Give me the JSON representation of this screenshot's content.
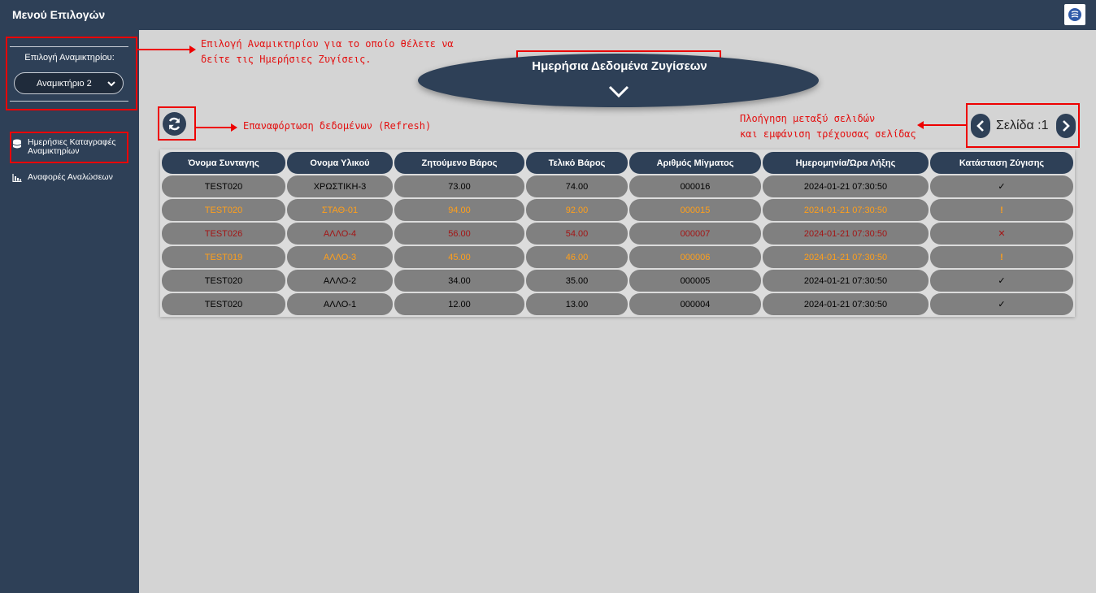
{
  "app": {
    "title": "Μενού Επιλογών"
  },
  "sidebar": {
    "select_label": "Επιλογή Αναμικτηρίου:",
    "select_value": "Αναμικτήριο 2",
    "items": [
      {
        "label": "Ημερήσιες Καταγραφές Αναμικτηρίων",
        "icon": "database-icon"
      },
      {
        "label": "Αναφορές Αναλώσεων",
        "icon": "bar-chart-icon"
      }
    ]
  },
  "main": {
    "heading": "Ημερήσια Δεδομένα Ζυγίσεων",
    "page_label": "Σελίδα :1"
  },
  "annotations": {
    "select_line1": "Επιλογή Αναμικτηρίου για το οποίο θέλετε να",
    "select_line2": "δείτε τις Ημερήσιες Ζυγίσεις.",
    "refresh": "Επαναφόρτωση δεδομένων (Refresh)",
    "paging_line1": "Πλοήγηση μεταξύ σελιδών",
    "paging_line2": "και εμφάνιση τρέχουσας σελίδας"
  },
  "colors": {
    "primary": "#2e4057",
    "ok": "#000000",
    "warning": "#ff9f1a",
    "error": "#a31515",
    "annotation": "#e31010"
  },
  "table": {
    "columns": [
      "Όνομα Συνταγης",
      "Ονομα Υλικού",
      "Ζητούμενο Βάρος",
      "Τελικό Βάρος",
      "Αριθμός Μίγματος",
      "Ημερομηνία/Ώρα Λήξης",
      "Κατάσταση Ζύγισης"
    ],
    "rows": [
      {
        "cells": [
          "TEST020",
          "ΧΡΩΣΤΙΚΗ-3",
          "73.00",
          "74.00",
          "000016",
          "2024-01-21 07:30:50",
          "✓"
        ],
        "status": "ok"
      },
      {
        "cells": [
          "TEST020",
          "ΣΤΑΘ-01",
          "94.00",
          "92.00",
          "000015",
          "2024-01-21 07:30:50",
          "!"
        ],
        "status": "warning"
      },
      {
        "cells": [
          "TEST026",
          "ΑΛΛΟ-4",
          "56.00",
          "54.00",
          "000007",
          "2024-01-21 07:30:50",
          "✕"
        ],
        "status": "error"
      },
      {
        "cells": [
          "TEST019",
          "ΑΛΛΟ-3",
          "45.00",
          "46.00",
          "000006",
          "2024-01-21 07:30:50",
          "!"
        ],
        "status": "warning"
      },
      {
        "cells": [
          "TEST020",
          "ΑΛΛΟ-2",
          "34.00",
          "35.00",
          "000005",
          "2024-01-21 07:30:50",
          "✓"
        ],
        "status": "ok"
      },
      {
        "cells": [
          "TEST020",
          "ΑΛΛΟ-1",
          "12.00",
          "13.00",
          "000004",
          "2024-01-21 07:30:50",
          "✓"
        ],
        "status": "ok"
      }
    ]
  }
}
